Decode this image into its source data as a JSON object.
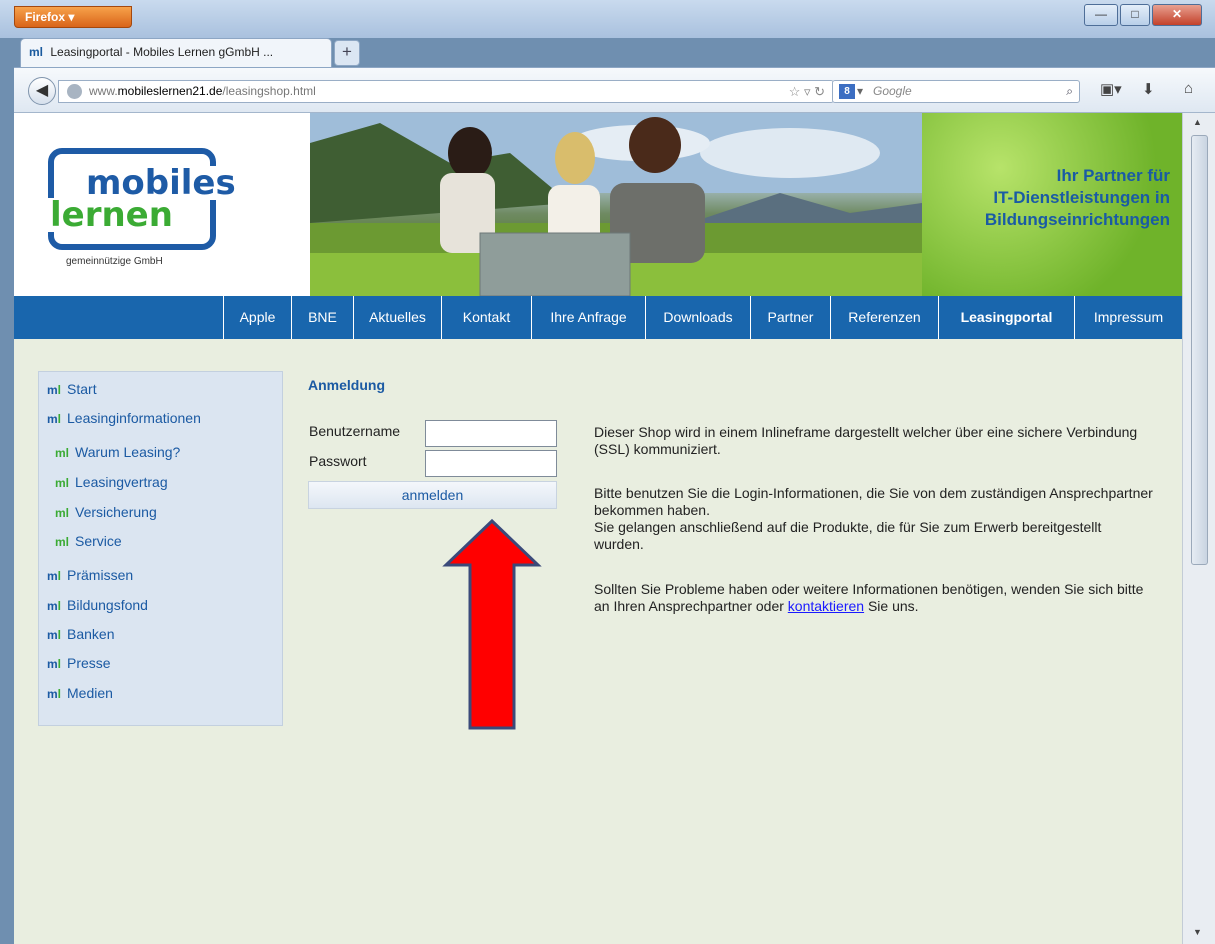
{
  "browser": {
    "app_button": "Firefox",
    "tab_title": "Leasingportal - Mobiles Lernen gGmbH ...",
    "tab_icon": "ml",
    "new_tab": "+",
    "url_scheme_host_prefix": "www.",
    "url_domain": "mobileslernen21.de",
    "url_path": "/leasingshop.html",
    "search_placeholder": "Google",
    "search_engine_icon": "8",
    "window_controls": [
      "minimize",
      "maximize",
      "close"
    ]
  },
  "header": {
    "logo_top": "mobiles",
    "logo_bottom": "lernen",
    "logo_sub": "gemeinnützige GmbH",
    "slogan_lines": [
      "Ihr Partner für",
      "IT-Dienstleistungen in",
      "Bildungseinrichtungen"
    ]
  },
  "menu": {
    "items": [
      "Apple",
      "BNE",
      "Aktuelles",
      "Kontakt",
      "Ihre Anfrage",
      "Downloads",
      "Partner",
      "Referenzen",
      "Leasingportal",
      "Impressum"
    ],
    "active": "Leasingportal"
  },
  "sidebar": {
    "items": [
      {
        "label": "Start"
      },
      {
        "label": "Leasinginformationen"
      },
      {
        "label": "Warum Leasing?"
      },
      {
        "label": "Leasingvertrag"
      },
      {
        "label": "Versicherung"
      },
      {
        "label": "Service"
      },
      {
        "label": "Prämissen"
      },
      {
        "label": "Bildungsfond"
      },
      {
        "label": "Banken"
      },
      {
        "label": "Presse"
      },
      {
        "label": "Medien"
      }
    ]
  },
  "login": {
    "title": "Anmeldung",
    "username_label": "Benutzername",
    "password_label": "Passwort",
    "username_value": "",
    "password_value": "",
    "submit_label": "anmelden"
  },
  "info": {
    "p1": "Dieser Shop wird in einem Inlineframe dargestellt welcher über eine sichere Verbindung (SSL) kommuniziert.",
    "p2a": "Bitte benutzen Sie die Login-Informationen, die Sie von dem zuständigen Ansprechpartner bekommen haben.",
    "p2b": "Sie gelangen anschließend auf die Produkte, die für Sie zum Erwerb bereitgestellt wurden.",
    "p3_before": "Sollten Sie Probleme haben oder weitere Informationen benötigen, wenden Sie sich bitte an Ihren Ansprechpartner oder",
    "p3_link": "kontaktieren",
    "p3_after": "Sie uns."
  },
  "colors": {
    "brand_blue": "#1966ad",
    "brand_green": "#3bab34",
    "page_bg": "#e9eee0",
    "annotation_arrow": "#ff0000"
  }
}
